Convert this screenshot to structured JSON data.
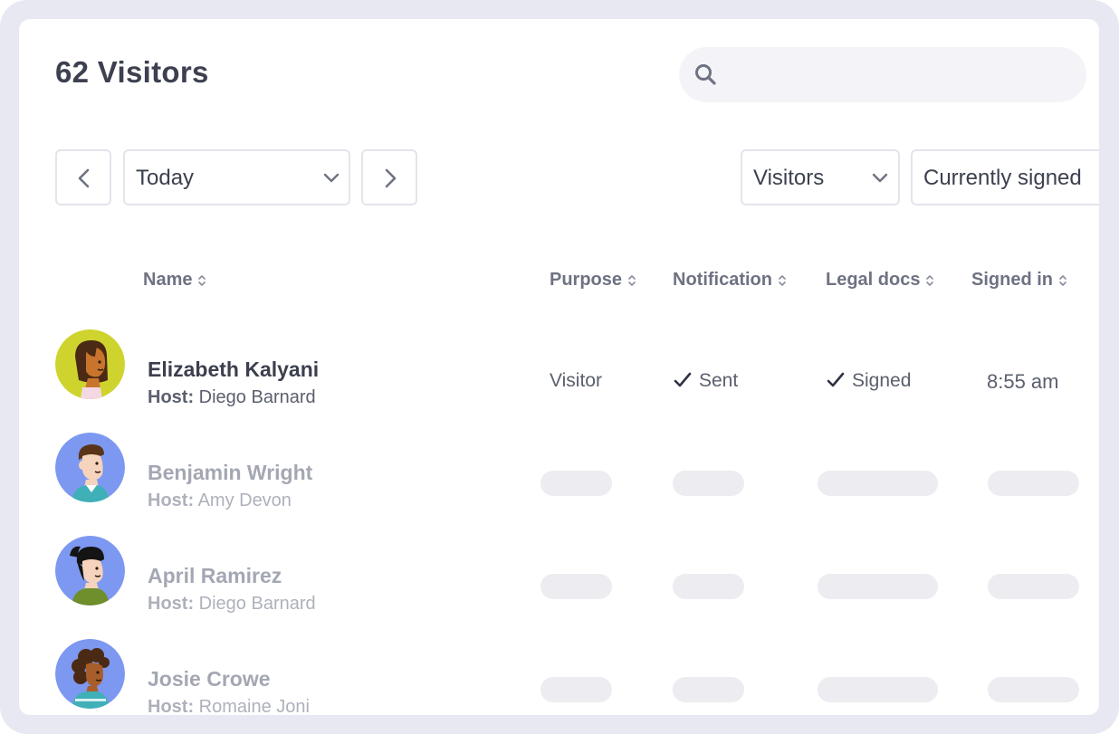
{
  "header": {
    "title": "62 Visitors",
    "search_placeholder": ""
  },
  "toolbar": {
    "date_filter": "Today",
    "type_filter": "Visitors",
    "status_filter": "Currently signed"
  },
  "table": {
    "columns": [
      "Name",
      "Purpose",
      "Notification",
      "Legal docs",
      "Signed in"
    ],
    "host_prefix": "Host:",
    "rows": [
      {
        "name": "Elizabeth Kalyani",
        "host": "Diego Barnard",
        "purpose": "Visitor",
        "notification": "Sent",
        "legal_docs": "Signed",
        "signed_in": "8:55 am",
        "loading": false
      },
      {
        "name": "Benjamin Wright",
        "host": "Amy Devon",
        "loading": true
      },
      {
        "name": "April Ramirez",
        "host": "Diego Barnard",
        "loading": true
      },
      {
        "name": "Josie Crowe",
        "host": "Romaine Joni",
        "loading": true
      }
    ]
  },
  "icons": {
    "search": "search-icon",
    "prev": "chevron-left-icon",
    "next": "chevron-right-icon",
    "dropdown": "chevron-down-icon",
    "sort": "sort-icon",
    "check": "check-icon"
  },
  "colors": {
    "frame": "#e8e8f2",
    "avatar_yellow": "#cfd32e",
    "avatar_blue": "#7d98f0",
    "skeleton": "#ececf1"
  }
}
